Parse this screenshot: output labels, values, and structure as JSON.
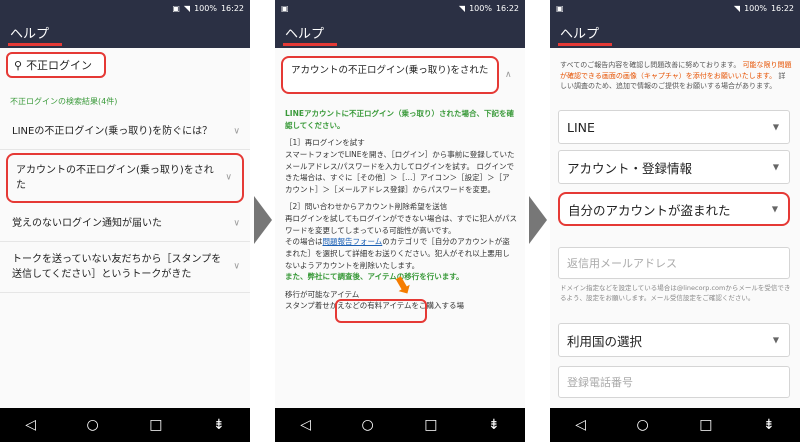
{
  "status": {
    "battery": "100%",
    "time": "16:22"
  },
  "appbar_title": "ヘルプ",
  "panel1": {
    "search_value": "不正ログイン",
    "results_label": "不正ログインの検索結果(4件)",
    "items": [
      "LINEの不正ログイン(乗っ取り)を防ぐには？",
      "アカウントの不正ログイン(乗っ取り)をされた",
      "覚えのないログイン通知が届いた",
      "トークを送っていない友だちから［スタンプを送信してください］というトークがきた"
    ]
  },
  "panel2": {
    "question": "アカウントの不正ログイン(乗っ取り)をされた",
    "lead": "LINEアカウントに不正ログイン（乗っ取り）された場合、下記を確認してください。",
    "sec1_title": "［1］再ログインを試す",
    "sec1_body": "スマートフォンでLINEを開き、［ログイン］から事前に登録していたメールアドレス/パスワードを入力してログインを試す。",
    "sec1_body2": "ログインできた場合は、すぐに［その他］＞［…］アイコン＞［設定］＞［アカウント］＞［メールアドレス登録］からパスワードを変更。",
    "sec2_title": "［2］問い合わせからアカウント削除希望を送信",
    "sec2_body": "再ログインを試してもログインができない場合は、すでに犯人がパスワードを変更してしまっている可能性が高いです。",
    "sec2_pre": "その場合は",
    "form_link": "問題報告フォーム",
    "sec2_post": "のカテゴリで［自分のアカウントが盗まれた］を選択して詳細をお送りください。犯人がそれ以上悪用しないようアカウントを削除いたします。",
    "sec2_green": "また、弊社にて調査後、アイテムの移行を行います。",
    "sec3_title": "移行が可能なアイテム",
    "sec3_body": "スタンプ着せかえなどの有料アイテムをご購入する場"
  },
  "panel3": {
    "intro": "すべてのご報告内容を確認し問題改善に努めております。",
    "intro_orange": "可能な限り問題が確認できる画面の画像（キャプチャ）を添付をお願いいたします。",
    "intro_rest": "詳しい調査のため、追加で情報のご提供をお願いする場合があります。",
    "select1": "LINE",
    "select2": "アカウント・登録情報",
    "select3": "自分のアカウントが盗まれた",
    "email_placeholder": "返信用メールアドレス",
    "note": "ドメイン指定などを設定している場合は@linecorp.comからメールを受信できるよう、設定をお願いします。メール受信設定をご確認ください。",
    "select4": "利用国の選択",
    "phone_placeholder": "登録電話番号"
  },
  "nav": {
    "back": "◁",
    "home": "○",
    "recent": "□",
    "menu": "⇟"
  },
  "colors": {
    "appbar": "#2b3044",
    "highlight": "#e53935",
    "green": "#3a9a3a"
  }
}
